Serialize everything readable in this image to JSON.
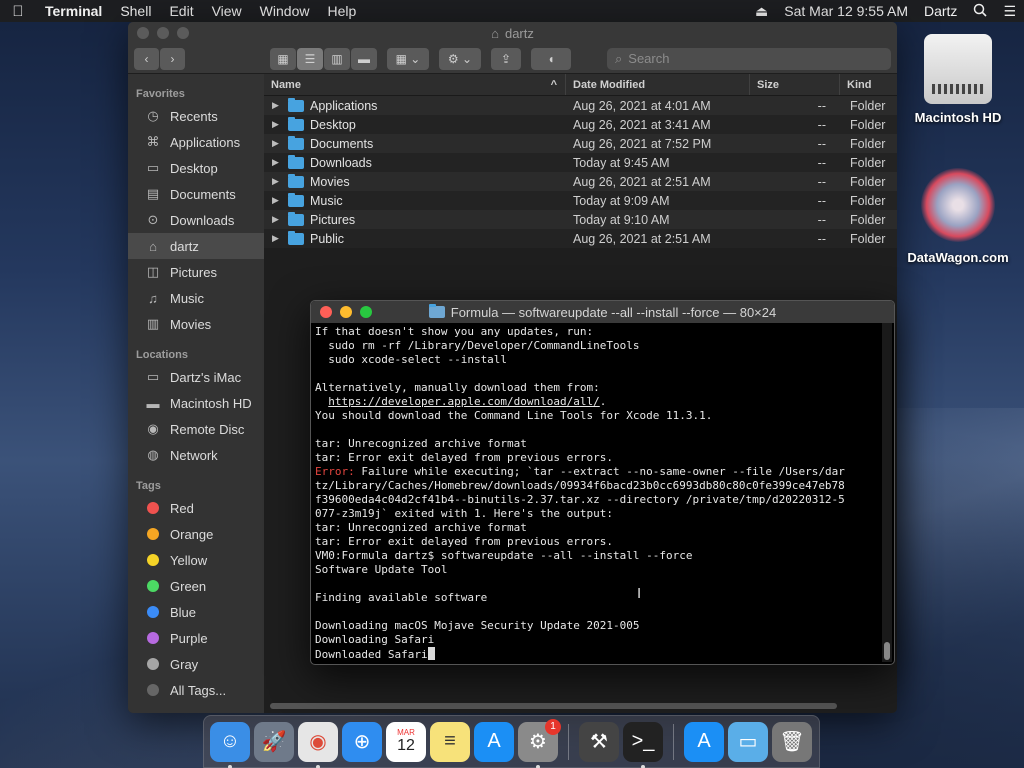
{
  "menubar": {
    "app": "Terminal",
    "items": [
      "Shell",
      "Edit",
      "View",
      "Window",
      "Help"
    ],
    "datetime": "Sat Mar 12  9:55 AM",
    "user": "Dartz"
  },
  "finder": {
    "title": "dartz",
    "search_placeholder": "Search",
    "sidebar": {
      "favorites_header": "Favorites",
      "favorites": [
        {
          "label": "Recents",
          "icon": "clock-icon"
        },
        {
          "label": "Applications",
          "icon": "applications-icon"
        },
        {
          "label": "Desktop",
          "icon": "desktop-icon"
        },
        {
          "label": "Documents",
          "icon": "document-icon"
        },
        {
          "label": "Downloads",
          "icon": "download-icon"
        },
        {
          "label": "dartz",
          "icon": "home-icon"
        },
        {
          "label": "Pictures",
          "icon": "camera-icon"
        },
        {
          "label": "Music",
          "icon": "music-icon"
        },
        {
          "label": "Movies",
          "icon": "film-icon"
        }
      ],
      "locations_header": "Locations",
      "locations": [
        {
          "label": "Dartz's iMac",
          "icon": "imac-icon"
        },
        {
          "label": "Macintosh HD",
          "icon": "disk-icon"
        },
        {
          "label": "Remote Disc",
          "icon": "disc-icon"
        },
        {
          "label": "Network",
          "icon": "globe-icon"
        }
      ],
      "tags_header": "Tags",
      "tags": [
        {
          "label": "Red",
          "color": "#f0524f"
        },
        {
          "label": "Orange",
          "color": "#f5a623"
        },
        {
          "label": "Yellow",
          "color": "#f5d327"
        },
        {
          "label": "Green",
          "color": "#4cd964"
        },
        {
          "label": "Blue",
          "color": "#3b8cf7"
        },
        {
          "label": "Purple",
          "color": "#b76ae0"
        },
        {
          "label": "Gray",
          "color": "#a6a6a6"
        },
        {
          "label": "All Tags...",
          "color": "#666666"
        }
      ]
    },
    "columns": {
      "name": "Name",
      "date": "Date Modified",
      "size": "Size",
      "kind": "Kind"
    },
    "rows": [
      {
        "name": "Applications",
        "date": "Aug 26, 2021 at 4:01 AM",
        "size": "--",
        "kind": "Folder"
      },
      {
        "name": "Desktop",
        "date": "Aug 26, 2021 at 3:41 AM",
        "size": "--",
        "kind": "Folder"
      },
      {
        "name": "Documents",
        "date": "Aug 26, 2021 at 7:52 PM",
        "size": "--",
        "kind": "Folder"
      },
      {
        "name": "Downloads",
        "date": "Today at 9:45 AM",
        "size": "--",
        "kind": "Folder"
      },
      {
        "name": "Movies",
        "date": "Aug 26, 2021 at 2:51 AM",
        "size": "--",
        "kind": "Folder"
      },
      {
        "name": "Music",
        "date": "Today at 9:09 AM",
        "size": "--",
        "kind": "Folder"
      },
      {
        "name": "Pictures",
        "date": "Today at 9:10 AM",
        "size": "--",
        "kind": "Folder"
      },
      {
        "name": "Public",
        "date": "Aug 26, 2021 at 2:51 AM",
        "size": "--",
        "kind": "Folder"
      }
    ]
  },
  "terminal": {
    "title": "Formula — softwareupdate --all --install --force — 80×24",
    "lines": [
      {
        "text": "If that doesn't show you any updates, run:"
      },
      {
        "text": "  sudo rm -rf /Library/Developer/CommandLineTools"
      },
      {
        "text": "  sudo xcode-select --install"
      },
      {
        "text": ""
      },
      {
        "text": "Alternatively, manually download them from:"
      },
      {
        "text": "  ",
        "link": "https://developer.apple.com/download/all/",
        "after": "."
      },
      {
        "text": "You should download the Command Line Tools for Xcode 11.3.1."
      },
      {
        "text": ""
      },
      {
        "text": "tar: Unrecognized archive format"
      },
      {
        "text": "tar: Error exit delayed from previous errors."
      },
      {
        "error": "Error:",
        "text": " Failure while executing; `tar --extract --no-same-owner --file /Users/dar"
      },
      {
        "text": "tz/Library/Caches/Homebrew/downloads/09934f6bacd23b0cc6993db80c80c0fe399ce47eb78"
      },
      {
        "text": "f39600eda4c04d2cf41b4--binutils-2.37.tar.xz --directory /private/tmp/d20220312-5"
      },
      {
        "text": "077-z3m19j` exited with 1. Here's the output:"
      },
      {
        "text": "tar: Unrecognized archive format"
      },
      {
        "text": "tar: Error exit delayed from previous errors."
      },
      {
        "text": "VM0:Formula dartz$ softwareupdate --all --install --force"
      },
      {
        "text": "Software Update Tool"
      },
      {
        "text": ""
      },
      {
        "text": "Finding available software"
      },
      {
        "text": ""
      },
      {
        "text": "Downloading macOS Mojave Security Update 2021-005"
      },
      {
        "text": "Downloading Safari"
      },
      {
        "text": "Downloaded Safari",
        "cursor": true
      }
    ]
  },
  "desktop": {
    "icons": [
      {
        "label": "Macintosh HD"
      },
      {
        "label": "DataWagon.com"
      }
    ]
  },
  "dock": {
    "items": [
      {
        "name": "finder",
        "glyph": "☺",
        "color": "#3a8ee6",
        "running": true
      },
      {
        "name": "launchpad",
        "glyph": "🚀",
        "color": "#6f7a8a",
        "running": false
      },
      {
        "name": "chrome",
        "glyph": "◉",
        "color": "#e6e6e6",
        "running": true
      },
      {
        "name": "safari",
        "glyph": "⊕",
        "color": "#2f8df0",
        "running": false
      },
      {
        "name": "calendar",
        "glyph": "12",
        "color": "#ffffff",
        "running": false,
        "calendar_month": "MAR",
        "calendar_day": "12"
      },
      {
        "name": "notes",
        "glyph": "≡",
        "color": "#f7e27a",
        "running": false
      },
      {
        "name": "app-store",
        "glyph": "A",
        "color": "#1b8ff5",
        "running": false
      },
      {
        "name": "system-preferences",
        "glyph": "⚙",
        "color": "#8a8a8a",
        "running": true,
        "badge": "1"
      },
      {
        "name": "xcode-tools",
        "glyph": "⚒",
        "color": "#444444",
        "running": false
      },
      {
        "name": "terminal",
        "glyph": ">_",
        "color": "#222222",
        "running": true
      },
      {
        "name": "app-store-folder",
        "glyph": "A",
        "color": "#1b8ff5",
        "running": false
      },
      {
        "name": "downloads-folder",
        "glyph": "▭",
        "color": "#5aaee8",
        "running": false
      },
      {
        "name": "trash",
        "glyph": "🗑",
        "color": "#777777",
        "running": false
      }
    ]
  }
}
